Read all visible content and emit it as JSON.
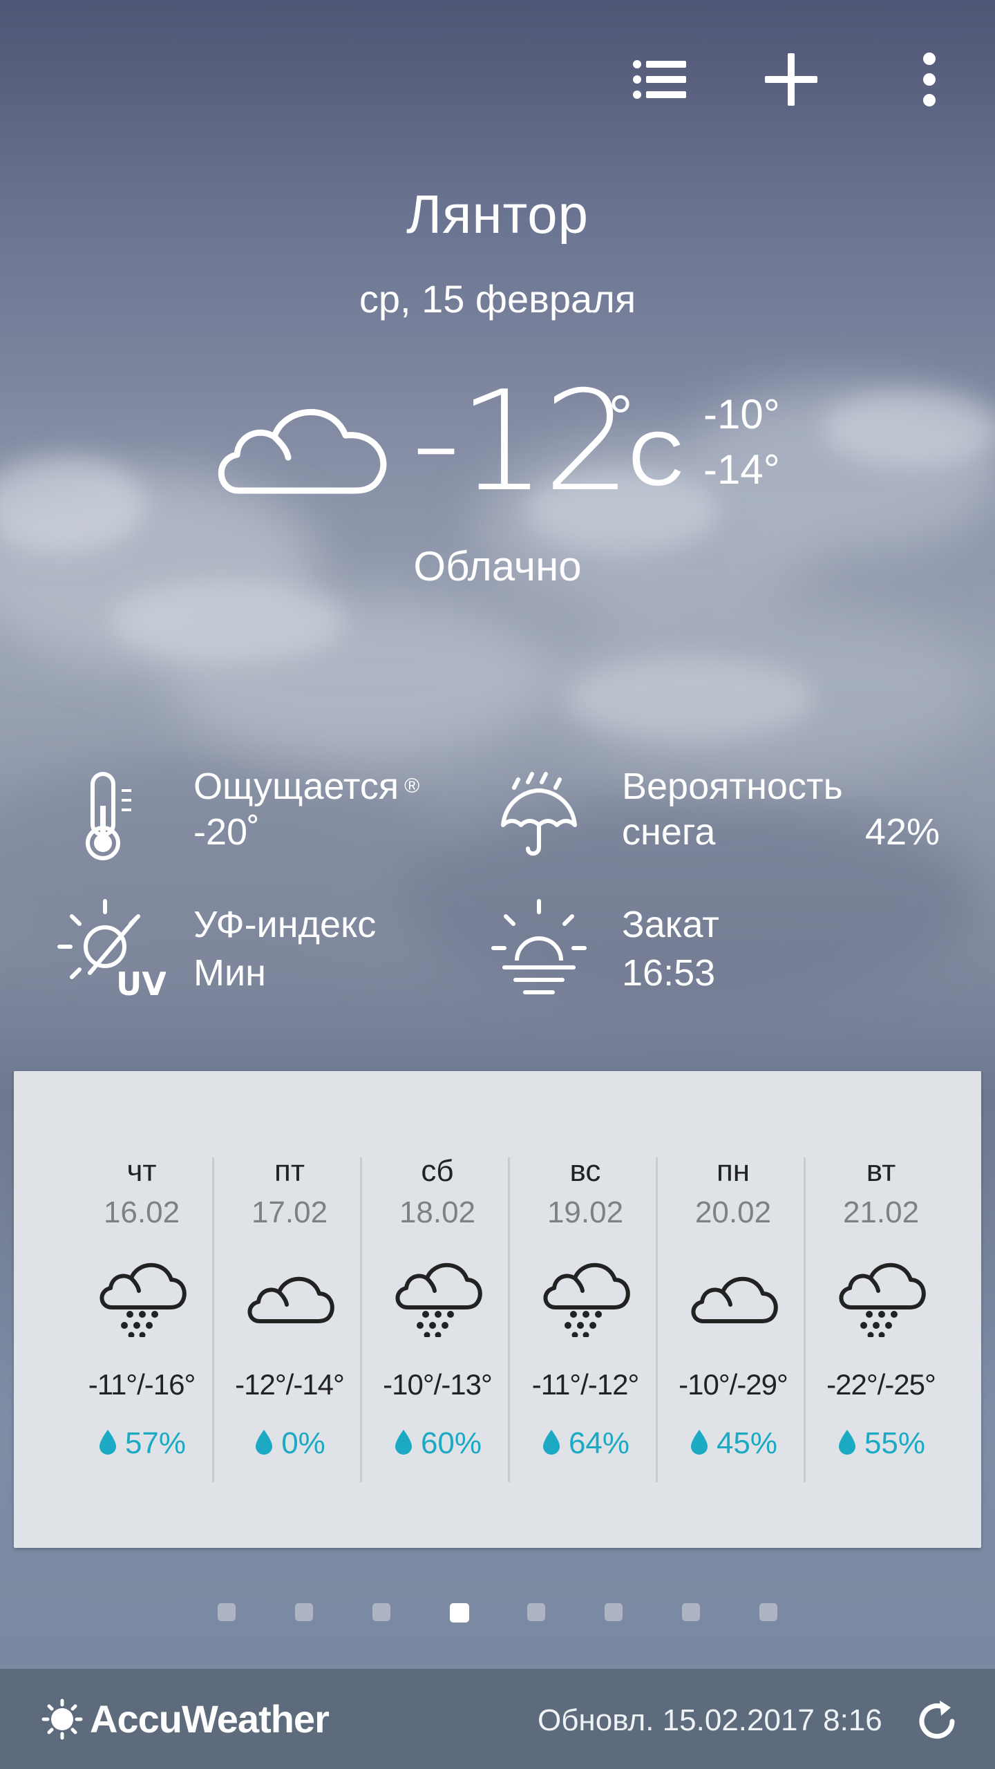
{
  "topbar": {
    "icons": [
      "list-icon",
      "plus-icon",
      "more-vert-icon"
    ]
  },
  "location": {
    "city": "Лянтор",
    "date": "ср, 15 февраля"
  },
  "current": {
    "icon": "cloud-icon",
    "temp": "-12",
    "deg": "°",
    "unit": "C",
    "high": "-10°",
    "low": "-14°",
    "condition": "Облачно"
  },
  "details": {
    "feels_like": {
      "label": "Ощущается",
      "mark": "®",
      "value": "-20˚",
      "icon": "thermometer-icon"
    },
    "snow_chance": {
      "label_line1": "Вероятность",
      "label_line2": "снега",
      "value": "42%",
      "icon": "umbrella-icon"
    },
    "uv": {
      "label": "УФ-индекс",
      "value": "Мин",
      "icon": "uv-icon"
    },
    "sunset": {
      "label": "Закат",
      "value": "16:53",
      "icon": "sunset-icon"
    }
  },
  "forecast": [
    {
      "day": "чт",
      "date": "16.02",
      "icon": "snow-icon",
      "temp": "-11°/-16°",
      "precip": "57%"
    },
    {
      "day": "пт",
      "date": "17.02",
      "icon": "cloud-icon",
      "temp": "-12°/-14°",
      "precip": "0%"
    },
    {
      "day": "сб",
      "date": "18.02",
      "icon": "snow-icon",
      "temp": "-10°/-13°",
      "precip": "60%"
    },
    {
      "day": "вс",
      "date": "19.02",
      "icon": "snow-icon",
      "temp": "-11°/-12°",
      "precip": "64%"
    },
    {
      "day": "пн",
      "date": "20.02",
      "icon": "cloud-icon",
      "temp": "-10°/-29°",
      "precip": "45%"
    },
    {
      "day": "вт",
      "date": "21.02",
      "icon": "snow-icon",
      "temp": "-22°/-25°",
      "precip": "55%"
    }
  ],
  "pager": {
    "count": 8,
    "active_index": 3
  },
  "footer": {
    "brand": "AccuWeather",
    "updated": "Обновл. 15.02.2017 8:16",
    "refresh_icon": "refresh-icon"
  },
  "colors": {
    "precip_accent": "#1ba9c4",
    "footer_bg": "#5d6b7c",
    "card_bg": "#dfe3e7"
  }
}
